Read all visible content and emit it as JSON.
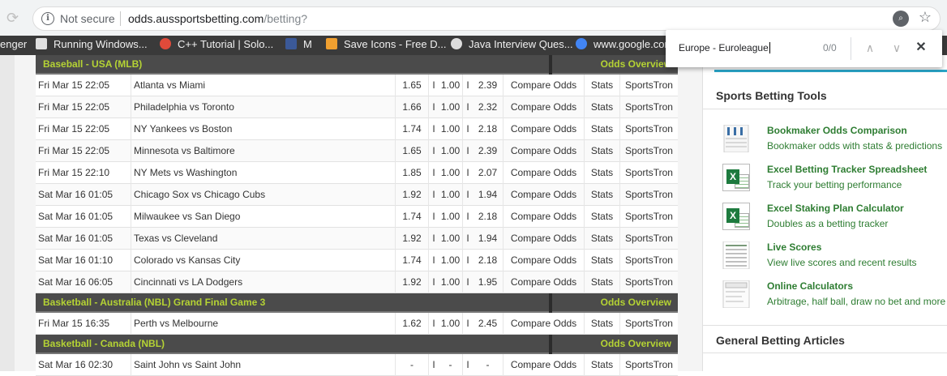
{
  "browser": {
    "not_secure": "Not secure",
    "url_host": "odds.aussportsbetting.com",
    "url_path": "/betting?",
    "info_icon": "info-icon",
    "zoom_icon": "zoom-icon",
    "star_icon": "bookmark-star-icon"
  },
  "bookmarks": [
    {
      "label": "enger",
      "icon": "none",
      "color": "#3a3a3a"
    },
    {
      "label": "Running Windows...",
      "icon": "page-icon",
      "color": "#e0e0e0"
    },
    {
      "label": "C++ Tutorial | Solo...",
      "icon": "sololearn-icon",
      "color": "#e04a3a"
    },
    {
      "label": "M",
      "icon": "facebook-icon",
      "color": "#3b5998"
    },
    {
      "label": "Save Icons - Free D...",
      "icon": "save-icons-icon",
      "color": "#f0a030"
    },
    {
      "label": "Java Interview Ques...",
      "icon": "link-icon",
      "color": "#dddddd"
    },
    {
      "label": "www.google.com",
      "icon": "google-icon",
      "color": "#4285f4"
    }
  ],
  "findbar": {
    "query": "Europe - Euroleague",
    "count": "0/0",
    "prev": "∧",
    "next": "∨",
    "close": "✕"
  },
  "odds": {
    "overview_label": "Odds Overview",
    "compare_label": "Compare Odds",
    "stats_label": "Stats",
    "sportstron_label": "SportsTron",
    "sections": [
      {
        "name": "Baseball - USA (MLB)",
        "rows": [
          {
            "date": "Fri Mar 15 22:05",
            "match": "Atlanta vs Miami",
            "o1": "1.65",
            "od": "1.00",
            "o2": "2.39"
          },
          {
            "date": "Fri Mar 15 22:05",
            "match": "Philadelphia vs Toronto",
            "o1": "1.66",
            "od": "1.00",
            "o2": "2.32"
          },
          {
            "date": "Fri Mar 15 22:05",
            "match": "NY Yankees vs Boston",
            "o1": "1.74",
            "od": "1.00",
            "o2": "2.18"
          },
          {
            "date": "Fri Mar 15 22:05",
            "match": "Minnesota vs Baltimore",
            "o1": "1.65",
            "od": "1.00",
            "o2": "2.39"
          },
          {
            "date": "Fri Mar 15 22:10",
            "match": "NY Mets vs Washington",
            "o1": "1.85",
            "od": "1.00",
            "o2": "2.07"
          },
          {
            "date": "Sat Mar 16 01:05",
            "match": "Chicago Sox vs Chicago Cubs",
            "o1": "1.92",
            "od": "1.00",
            "o2": "1.94"
          },
          {
            "date": "Sat Mar 16 01:05",
            "match": "Milwaukee vs San Diego",
            "o1": "1.74",
            "od": "1.00",
            "o2": "2.18"
          },
          {
            "date": "Sat Mar 16 01:05",
            "match": "Texas vs Cleveland",
            "o1": "1.92",
            "od": "1.00",
            "o2": "1.94"
          },
          {
            "date": "Sat Mar 16 01:10",
            "match": "Colorado vs Kansas City",
            "o1": "1.74",
            "od": "1.00",
            "o2": "2.18"
          },
          {
            "date": "Sat Mar 16 06:05",
            "match": "Cincinnati vs LA Dodgers",
            "o1": "1.92",
            "od": "1.00",
            "o2": "1.95"
          }
        ]
      },
      {
        "name": "Basketball - Australia (NBL) Grand Final Game 3",
        "rows": [
          {
            "date": "Fri Mar 15 16:35",
            "match": "Perth vs Melbourne",
            "o1": "1.62",
            "od": "1.00",
            "o2": "2.45"
          }
        ]
      },
      {
        "name": "Basketball - Canada (NBL)",
        "rows": [
          {
            "date": "Sat Mar 16 02:30",
            "match": "Saint John vs Saint John",
            "o1": "-",
            "od": "-",
            "o2": "-"
          }
        ]
      }
    ]
  },
  "sidebar": {
    "tools_heading": "Sports Betting Tools",
    "articles_heading": "General Betting Articles",
    "tools": [
      {
        "title": "Bookmaker Odds Comparison",
        "desc": "Bookmaker odds with stats & predictions",
        "icon": "odds-comparison-icon"
      },
      {
        "title": "Excel Betting Tracker Spreadsheet",
        "desc": "Track your betting performance",
        "icon": "excel-icon"
      },
      {
        "title": "Excel Staking Plan Calculator",
        "desc": "Doubles as a betting tracker",
        "icon": "excel-icon"
      },
      {
        "title": "Live Scores",
        "desc": "View live scores and recent results",
        "icon": "live-scores-icon"
      },
      {
        "title": "Online Calculators",
        "desc": "Arbitrage, half ball, draw no bet and more",
        "icon": "calculator-icon"
      }
    ]
  }
}
